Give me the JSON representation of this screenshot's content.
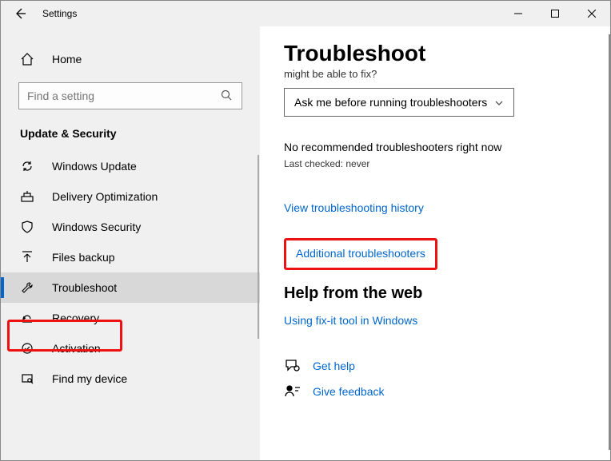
{
  "window": {
    "title": "Settings"
  },
  "sidebar": {
    "home": "Home",
    "search_placeholder": "Find a setting",
    "section": "Update & Security",
    "items": [
      {
        "icon": "refresh-icon",
        "label": "Windows Update"
      },
      {
        "icon": "delivery-icon",
        "label": "Delivery Optimization"
      },
      {
        "icon": "shield-icon",
        "label": "Windows Security"
      },
      {
        "icon": "backup-icon",
        "label": "Files backup"
      },
      {
        "icon": "wrench-icon",
        "label": "Troubleshoot"
      },
      {
        "icon": "recovery-icon",
        "label": "Recovery"
      },
      {
        "icon": "activation-icon",
        "label": "Activation"
      },
      {
        "icon": "find-device-icon",
        "label": "Find my device"
      }
    ],
    "selected_index": 4
  },
  "main": {
    "title": "Troubleshoot",
    "subtitle_fragment": "might be able to fix?",
    "dropdown_value": "Ask me before running troubleshooters",
    "no_recommended": "No recommended troubleshooters right now",
    "last_checked": "Last checked: never",
    "view_history": "View troubleshooting history",
    "additional": "Additional troubleshooters",
    "help_header": "Help from the web",
    "help_link": "Using fix-it tool in Windows",
    "get_help": "Get help",
    "give_feedback": "Give feedback"
  }
}
